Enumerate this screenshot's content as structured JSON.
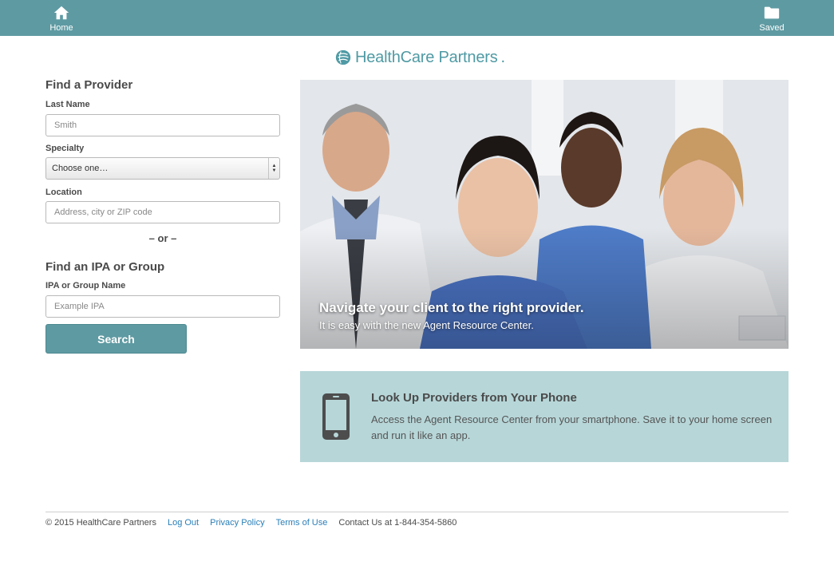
{
  "nav": {
    "home_label": "Home",
    "saved_label": "Saved"
  },
  "logo": {
    "text": "HealthCare Partners",
    "suffix": "."
  },
  "find_provider": {
    "heading": "Find a Provider",
    "last_name_label": "Last Name",
    "last_name_placeholder": "Smith",
    "specialty_label": "Specialty",
    "specialty_selected": "Choose one…",
    "location_label": "Location",
    "location_placeholder": "Address, city or ZIP code"
  },
  "or_divider": "– or –",
  "find_group": {
    "heading": "Find an IPA or Group",
    "name_label": "IPA or Group Name",
    "name_placeholder": "Example IPA"
  },
  "search_button": "Search",
  "hero": {
    "headline": "Navigate your client to the right provider.",
    "subline": "It is easy with the new Agent Resource Center."
  },
  "phone_promo": {
    "title": "Look Up Providers from Your Phone",
    "text": "Access the Agent Resource Center from your smartphone. Save it to your home screen and run it like an app."
  },
  "footer": {
    "copyright": "© 2015 HealthCare Partners",
    "logout": "Log Out",
    "privacy": "Privacy Policy",
    "terms": "Terms of Use",
    "contact": "Contact Us at 1-844-354-5860"
  },
  "colors": {
    "brand": "#5e9aa2",
    "promo_bg": "#b7d6d8",
    "link": "#2a7fb8"
  }
}
